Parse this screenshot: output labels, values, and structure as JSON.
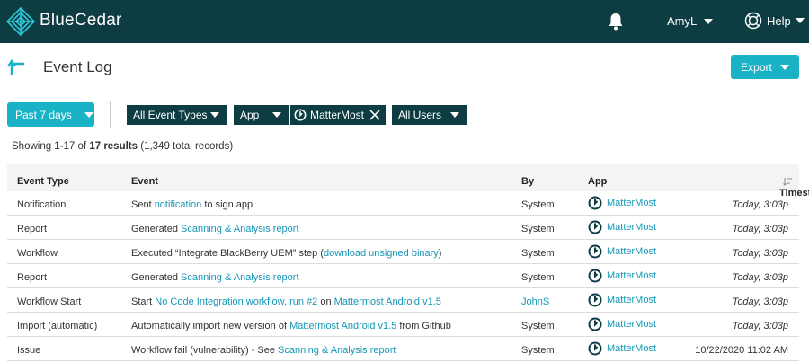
{
  "header": {
    "brand": "BlueCedar",
    "user_name": "AmyL",
    "help_label": "Help"
  },
  "page": {
    "title": "Event Log",
    "export_label": "Export"
  },
  "filters": {
    "date_range": "Past 7 days",
    "event_types": "All Event Types",
    "app_filter": "App",
    "app_chip": "MatterMost",
    "users": "All Users"
  },
  "results": {
    "prefix": "Showing 1-17 of",
    "count": "17 results",
    "total": "(1,349 total records)"
  },
  "table": {
    "columns": {
      "type": "Event Type",
      "event": "Event",
      "by": "By",
      "app": "App",
      "timestamp": "Timestamp"
    },
    "rows": [
      {
        "type": "Notification",
        "event": [
          {
            "t": "Sent ",
            "link": false
          },
          {
            "t": "notification",
            "link": true
          },
          {
            "t": " to sign app",
            "link": false
          }
        ],
        "by": "System",
        "by_link": false,
        "app": "MatterMost",
        "timestamp": "Today, 3:03p",
        "ts_italic": true
      },
      {
        "type": "Report",
        "event": [
          {
            "t": "Generated ",
            "link": false
          },
          {
            "t": "Scanning & Analysis report",
            "link": true
          }
        ],
        "by": "System",
        "by_link": false,
        "app": "MatterMost",
        "timestamp": "Today, 3:03p",
        "ts_italic": true
      },
      {
        "type": "Workflow",
        "event": [
          {
            "t": "Executed “Integrate BlackBerry UEM” step (",
            "link": false
          },
          {
            "t": "download unsigned binary",
            "link": true
          },
          {
            "t": ")",
            "link": false
          }
        ],
        "by": "System",
        "by_link": false,
        "app": "MatterMost",
        "timestamp": "Today, 3:03p",
        "ts_italic": true
      },
      {
        "type": "Report",
        "event": [
          {
            "t": "Generated ",
            "link": false
          },
          {
            "t": "Scanning & Analysis report",
            "link": true
          }
        ],
        "by": "System",
        "by_link": false,
        "app": "MatterMost",
        "timestamp": "Today, 3:03p",
        "ts_italic": true
      },
      {
        "type": "Workflow Start",
        "event": [
          {
            "t": "Start ",
            "link": false
          },
          {
            "t": "No Code Integration workflow, run #2",
            "link": true
          },
          {
            "t": " on ",
            "link": false
          },
          {
            "t": "Mattermost Android v1.5",
            "link": true
          }
        ],
        "by": "JohnS",
        "by_link": true,
        "app": "MatterMost",
        "timestamp": "Today, 3:03p",
        "ts_italic": true
      },
      {
        "type": "Import (automatic)",
        "event": [
          {
            "t": "Automatically import new version of ",
            "link": false
          },
          {
            "t": "Mattermost Android v1.5",
            "link": true
          },
          {
            "t": " from Github",
            "link": false
          }
        ],
        "by": "System",
        "by_link": false,
        "app": "MatterMost",
        "timestamp": "Today, 3:03p",
        "ts_italic": true
      },
      {
        "type": "Issue",
        "event": [
          {
            "t": "Workflow fail (vulnerability) - See ",
            "link": false
          },
          {
            "t": "Scanning & Analysis report",
            "link": true
          }
        ],
        "by": "System",
        "by_link": false,
        "app": "MatterMost",
        "timestamp": "10/22/2020  11:02 AM",
        "ts_italic": false
      }
    ]
  },
  "colors": {
    "header_bg": "#0d3d42",
    "accent": "#1ab2c5",
    "link": "#1497b8"
  },
  "icons": [
    "cedar-logo-icon",
    "bell-icon",
    "caret-down-icon",
    "help-lifebuoy-icon",
    "back-arrow-icon",
    "close-icon",
    "mattermost-icon",
    "sort-icon"
  ]
}
